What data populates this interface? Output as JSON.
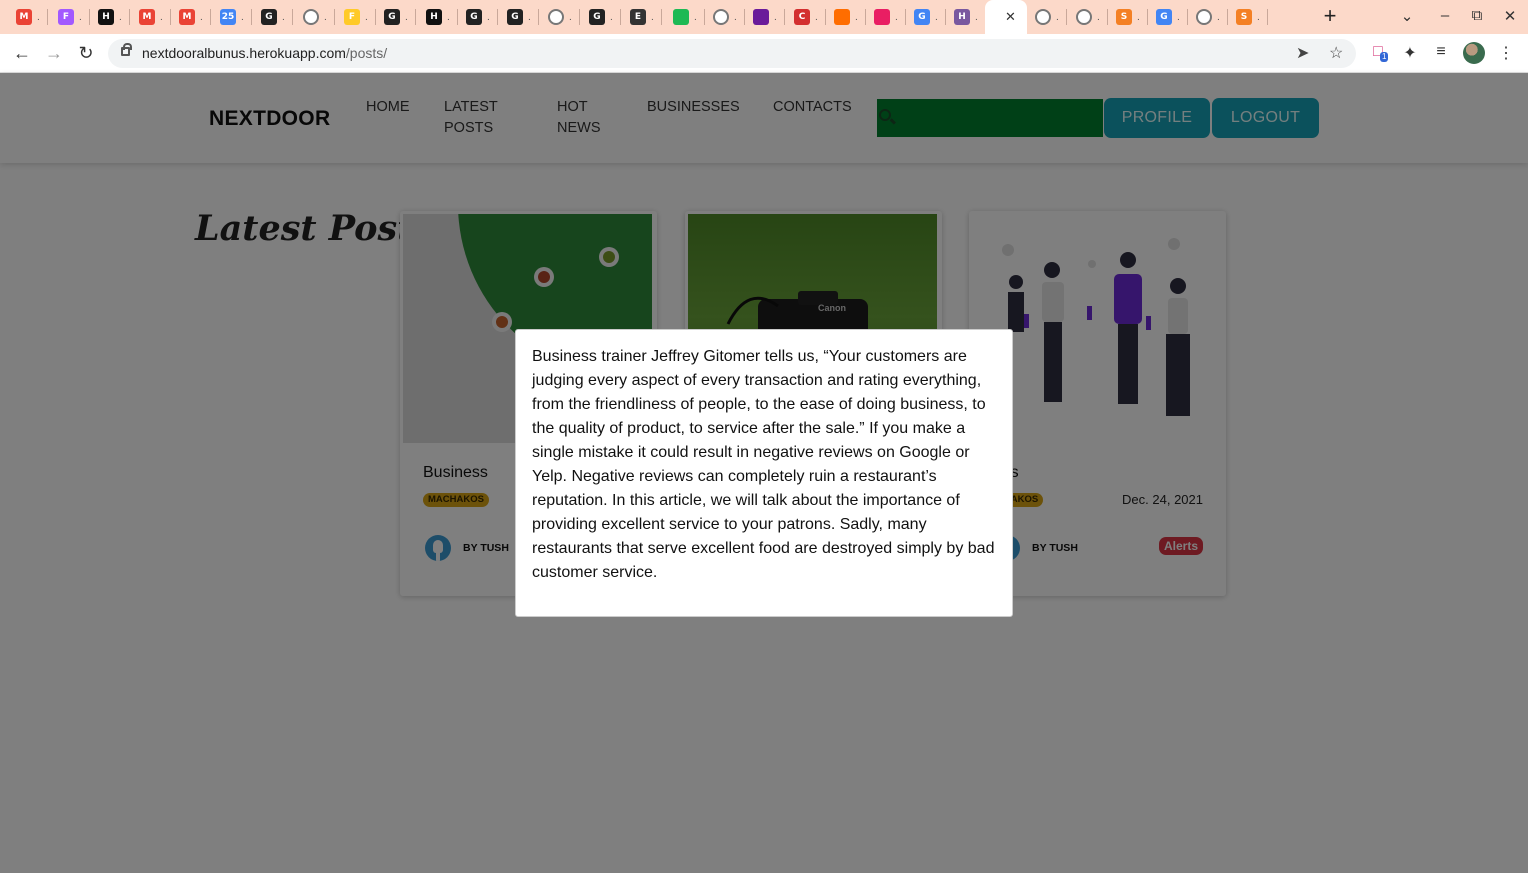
{
  "browser": {
    "url_host": "nextdooralbunus.herokuapp.com",
    "url_path": "/posts/",
    "tabs": [
      {
        "icon": "gmail-icon",
        "label": "M",
        "color": "#ea4335"
      },
      {
        "icon": "figma-icon",
        "label": "F",
        "color": "#a259ff"
      },
      {
        "icon": "hackernews-icon",
        "label": "H",
        "color": "#111111"
      },
      {
        "icon": "gmail-icon",
        "label": "M",
        "color": "#ea4335"
      },
      {
        "icon": "gmail-icon",
        "label": "M",
        "color": "#ea4335"
      },
      {
        "icon": "calendar-icon",
        "label": "25",
        "color": "#4285f4"
      },
      {
        "icon": "github-icon",
        "label": "G",
        "color": "#222222"
      },
      {
        "icon": "globe-icon",
        "label": "",
        "color": "#777777"
      },
      {
        "icon": "firebase-icon",
        "label": "F",
        "color": "#ffca28"
      },
      {
        "icon": "github-icon",
        "label": "G",
        "color": "#222222"
      },
      {
        "icon": "hackernews-icon",
        "label": "H",
        "color": "#111111"
      },
      {
        "icon": "github-icon",
        "label": "G",
        "color": "#222222"
      },
      {
        "icon": "github-icon",
        "label": "G",
        "color": "#222222"
      },
      {
        "icon": "globe-icon",
        "label": "",
        "color": "#777777"
      },
      {
        "icon": "github-icon",
        "label": "G",
        "color": "#222222"
      },
      {
        "icon": "audio-icon",
        "label": "E",
        "color": "#333333"
      },
      {
        "icon": "app-icon",
        "label": "",
        "color": "#1db954"
      },
      {
        "icon": "globe-icon",
        "label": "",
        "color": "#777777"
      },
      {
        "icon": "app-icon",
        "label": "",
        "color": "#6a1b9a"
      },
      {
        "icon": "app-icon",
        "label": "C",
        "color": "#d32f2f"
      },
      {
        "icon": "app-icon",
        "label": "",
        "color": "#ff6d00"
      },
      {
        "icon": "app-icon",
        "label": "",
        "color": "#e91e63"
      },
      {
        "icon": "google-icon",
        "label": "G",
        "color": "#4285f4"
      },
      {
        "icon": "heroku-icon",
        "label": "H",
        "color": "#79589f"
      },
      {
        "icon": "globe-icon",
        "label": "",
        "color": "#777777"
      },
      {
        "icon": "globe-icon",
        "label": "",
        "color": "#777777"
      },
      {
        "icon": "globe-icon",
        "label": "",
        "color": "#777777"
      },
      {
        "icon": "stackoverflow-icon",
        "label": "S",
        "color": "#f48024"
      },
      {
        "icon": "google-icon",
        "label": "G",
        "color": "#4285f4"
      },
      {
        "icon": "globe-icon",
        "label": "",
        "color": "#777777"
      },
      {
        "icon": "stackoverflow-icon",
        "label": "S",
        "color": "#f48024"
      }
    ],
    "extension_badge": "1"
  },
  "site": {
    "brand": "NEXTDOOR",
    "nav": {
      "home": "HOME",
      "latest_line1": "LATEST",
      "latest_line2": "POSTS",
      "hot_line1": "HOT",
      "hot_line2": "NEWS",
      "businesses": "BUSINESSES",
      "contacts": "CONTACTS"
    },
    "search": {
      "placeholder": ""
    },
    "profile_button": "PROFILE",
    "logout_button": "LOGOUT",
    "accent_color": "#17a2b8",
    "search_color": "#00802f"
  },
  "main": {
    "heading": "Latest Posts",
    "cards": [
      {
        "title": "Business",
        "location": "MACHAKOS",
        "date": "",
        "author": "BY TUSH",
        "category": ""
      },
      {
        "title": "",
        "location": "",
        "date": "",
        "author": "",
        "category": ""
      },
      {
        "title": "erts",
        "location": "CHAKOS",
        "date": "Dec. 24, 2021",
        "author": "BY TUSH",
        "category": "Alerts"
      }
    ]
  },
  "modal": {
    "text": "Business trainer Jeffrey Gitomer tells us, “Your customers are judging every aspect of every transaction and rating everything, from the friendliness of people, to the ease of doing business, to the quality of product, to service after the sale.” If you make a single mistake it could result in negative reviews on Google or Yelp. Negative reviews can completely ruin a restaurant’s reputation. In this article, we will talk about the importance of providing excellent service to your patrons. Sadly, many restaurants that serve excellent food are destroyed simply by bad customer service."
  }
}
